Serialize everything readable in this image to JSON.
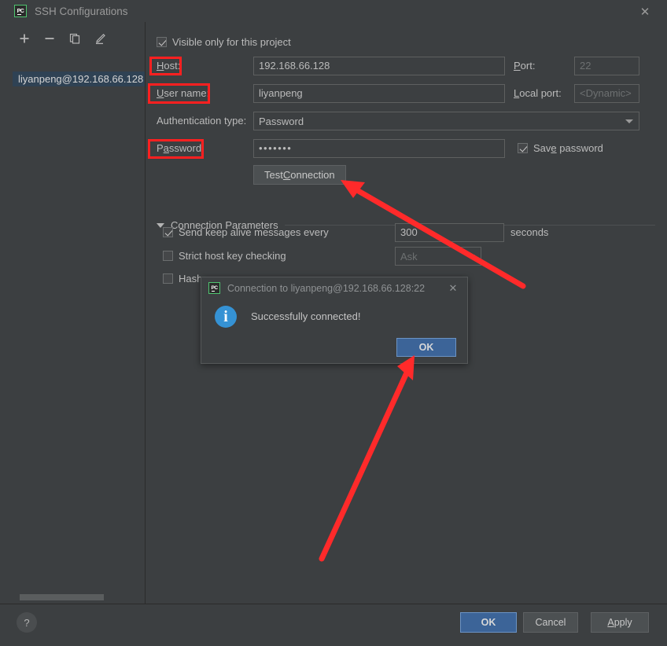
{
  "window": {
    "title": "SSH Configurations",
    "logo_text": "PC",
    "close_icon": "✕"
  },
  "sidebar": {
    "toolbar": [
      {
        "name": "add-button",
        "glyph": "＋"
      },
      {
        "name": "remove-button",
        "glyph": "−"
      },
      {
        "name": "copy-button",
        "glyph": "❐"
      },
      {
        "name": "edit-button",
        "glyph": "✎"
      }
    ],
    "items": [
      {
        "label": "liyanpeng@192.168.66.128",
        "selected": true
      }
    ]
  },
  "form": {
    "visible_only_checkbox": {
      "label": "Visible only for this project",
      "checked": true
    },
    "host": {
      "label": "Host:",
      "label_mnemonic": "H",
      "value": "192.168.66.128"
    },
    "port": {
      "label": "Port:",
      "label_mnemonic": "P",
      "value": "22",
      "is_placeholder": true
    },
    "user_name": {
      "label": "User name:",
      "label_mnemonic": "U",
      "value": "liyanpeng"
    },
    "local_port": {
      "label": "Local port:",
      "label_mnemonic": "L",
      "value": "<Dynamic>",
      "is_placeholder": true
    },
    "auth_type": {
      "label": "Authentication type:",
      "value": "Password"
    },
    "password": {
      "label": "Password:",
      "label_mnemonic": "a",
      "value": "•••••••"
    },
    "save_password_checkbox": {
      "label": "Save password",
      "checked": true
    },
    "test_connection_button": {
      "label": "Test Connection"
    }
  },
  "connection_parameters": {
    "section_title": "Connection Parameters",
    "keep_alive": {
      "label": "Send keep alive messages every",
      "checked": true,
      "value": "300",
      "unit": "seconds"
    },
    "strict_host_key": {
      "label": "Strict host key checking",
      "checked": false,
      "value": "Ask"
    },
    "hash": {
      "label": "Hash",
      "checked": false
    }
  },
  "dialog": {
    "title": "Connection to liyanpeng@192.168.66.128:22",
    "logo_text": "PC",
    "close_icon": "✕",
    "info_icon": "i",
    "message": "Successfully connected!",
    "ok_label": "OK"
  },
  "footer": {
    "help_label": "?",
    "ok_label": "OK",
    "cancel_label": "Cancel",
    "apply_label": "Apply",
    "apply_mnemonic": "A"
  },
  "annotations": {
    "highlight_color": "#ff2020",
    "arrow_color": "#ff2a2a",
    "boxes": [
      "Host:",
      "User name:",
      "Password:"
    ],
    "arrows": [
      "points-to-test-connection-button",
      "points-to-dialog-ok-button"
    ]
  }
}
